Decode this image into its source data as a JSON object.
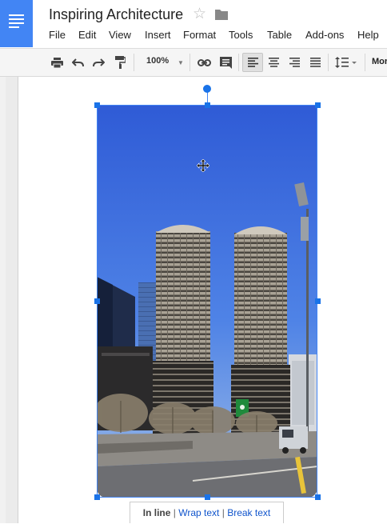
{
  "header": {
    "doc_title": "Inspiring Architecture",
    "icons": {
      "app": "docs-icon",
      "star": "star-icon",
      "folder": "folder-icon"
    }
  },
  "menu": {
    "file": "File",
    "edit": "Edit",
    "view": "View",
    "insert": "Insert",
    "format": "Format",
    "tools": "Tools",
    "table": "Table",
    "addons": "Add-ons",
    "help": "Help"
  },
  "toolbar": {
    "zoom": "100%",
    "more": "Mor",
    "buttons": [
      "print-icon",
      "undo-icon",
      "redo-icon",
      "paint-format-icon",
      "link-icon",
      "comment-icon",
      "align-left-icon",
      "align-center-icon",
      "align-right-icon",
      "justify-icon",
      "line-spacing-icon"
    ],
    "active_alignment": "left"
  },
  "image_options": {
    "inline": "In line",
    "separator": "|",
    "wrap": "Wrap text",
    "break": "Break text"
  },
  "colors": {
    "accent": "#4285f4",
    "handle": "#1a73e8",
    "link": "#1155cc"
  }
}
